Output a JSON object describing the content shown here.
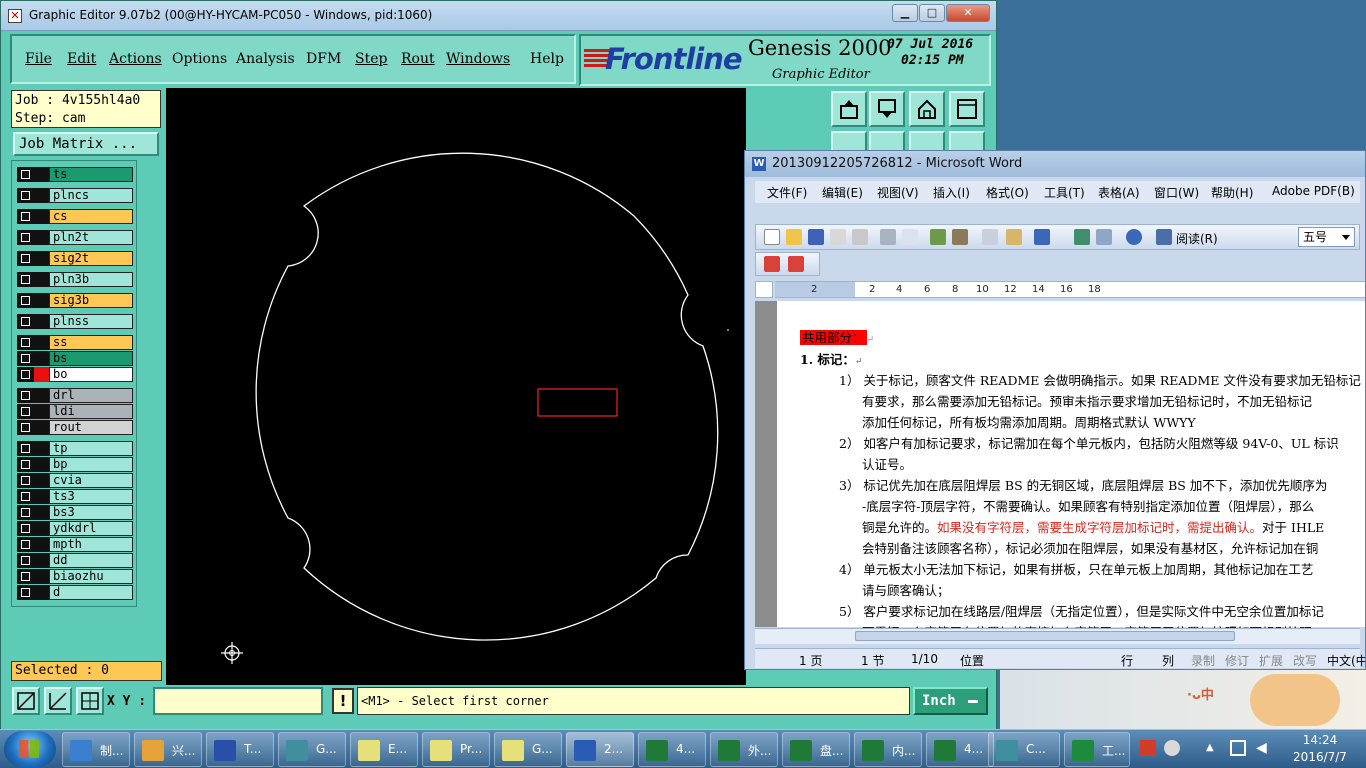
{
  "genesis": {
    "window_title": "Graphic Editor 9.07b2 (00@HY-HYCAM-PC050 - Windows, pid:1060)",
    "menu": [
      "File",
      "Edit",
      "Actions",
      "Options",
      "Analysis",
      "DFM",
      "Step",
      "Rout",
      "Windows",
      "Help"
    ],
    "brand": {
      "logo": "Frontline",
      "product": "Genesis 2000",
      "subtitle": "Graphic Editor",
      "date": "07 Jul 2016",
      "time": "02:15 PM"
    },
    "job_label": "Job : 4v155hl4a0",
    "step_label": "Step: cam",
    "job_matrix_button": "Job Matrix ...",
    "layers": [
      {
        "name": "ts",
        "color": "#1a9a6e"
      },
      {
        "name": "plncs",
        "color": "#9fe6d8"
      },
      {
        "name": "cs",
        "color": "#ffc753"
      },
      {
        "name": "pln2t",
        "color": "#9fe6d8"
      },
      {
        "name": "sig2t",
        "color": "#ffc753"
      },
      {
        "name": "pln3b",
        "color": "#9fe6d8"
      },
      {
        "name": "sig3b",
        "color": "#ffc753"
      },
      {
        "name": "plnss",
        "color": "#9fe6d8"
      },
      {
        "name": "ss",
        "color": "#ffc753"
      },
      {
        "name": "bs",
        "color": "#1a9a6e"
      },
      {
        "name": "bo",
        "color": "#ffffff"
      },
      {
        "name": "drl",
        "color": "#a9b3b8"
      },
      {
        "name": "ldi",
        "color": "#a9b3b8"
      },
      {
        "name": "rout",
        "color": "#d2d2d2"
      },
      {
        "name": "tp",
        "color": "#9fe6d8"
      },
      {
        "name": "bp",
        "color": "#9fe6d8"
      },
      {
        "name": "cvia",
        "color": "#9fe6d8"
      },
      {
        "name": "ts3",
        "color": "#9fe6d8"
      },
      {
        "name": "bs3",
        "color": "#9fe6d8"
      },
      {
        "name": "ydkdrl",
        "color": "#9fe6d8"
      },
      {
        "name": "mpth",
        "color": "#9fe6d8"
      },
      {
        "name": "dd",
        "color": "#9fe6d8"
      },
      {
        "name": "biaozhu",
        "color": "#9fe6d8"
      },
      {
        "name": "d",
        "color": "#9fe6d8"
      }
    ],
    "selected_label": "Selected : 0",
    "xy_label": "X Y :",
    "xy_value": "",
    "exclaim": "!",
    "prompt": "<M1> - Select first corner",
    "units": "Inch"
  },
  "word": {
    "window_title": "20130912205726812 - Microsoft Word",
    "menu": [
      "文件(F)",
      "编辑(E)",
      "视图(V)",
      "插入(I)",
      "格式(O)",
      "工具(T)",
      "表格(A)",
      "窗口(W)",
      "帮助(H)",
      "Adobe PDF(B)"
    ],
    "read_button": "阅读(R)",
    "font_size": "五号",
    "ruler_numbers": [
      "2",
      "2",
      "4",
      "6",
      "8",
      "10",
      "12",
      "14",
      "16",
      "18"
    ],
    "heading": "共用部分：",
    "section": "1.  标记：",
    "paragraphs": [
      "1） 关于标记，顾客文件 README 会做明确指示。如果 README 文件没有要求加无铅标记",
      "有要求，那么需要添加无铅标记。预审未指示要求增加无铅标记时，不加无铅标记",
      "添加任何标记，所有板均需添加周期。周期格式默认 WWYY",
      "2） 如客户有加标记要求，标记需加在每个单元板内，包括防火阻燃等级 94V-0、UL 标识",
      "认证号。",
      "3） 标记优先加在底层阻焊层 BS 的无铜区域，底层阻焊层 BS 加不下，添加优先顺序为",
      "-底层字符-顶层字符，不需要确认。如果顾客有特别指定添加位置（阻焊层），那么",
      "铜是允许的。",
      "如果没有字符层，需要生成字符层加标记时，需提出确认。",
      "对于 IHLE",
      "会特别备注该顾客名称），标记必须加在阻焊层，如果没有基材区，允许标记加在铜",
      "4） 单元板太小无法加下标记，如果有拼板，只在单元板上加周期，其他标记加在工艺",
      "请与顾客确认；",
      "5） 客户要求标记加在线路层/阻焊层（无指定位置），但是实际文件中无空余位置加标记",
      "面露铜，在字符层有位置加的直接加在字符层，字符层无位置加按照如下规则处理"
    ],
    "status": {
      "page": "1 页",
      "section": "1 节",
      "pages": "1/10",
      "position": "位置",
      "line": "行",
      "col": "列",
      "rec": "录制",
      "trk": "修订",
      "ext": "扩展",
      "ovr": "改写",
      "lang": "中文(中"
    }
  },
  "desktop": {
    "deco_text": "·ᴗ中"
  },
  "taskbar": {
    "items": [
      {
        "label": "制...",
        "color": "#3b7fd0"
      },
      {
        "label": "兴...",
        "color": "#e3a23a"
      },
      {
        "label": "T...",
        "color": "#2a4fa8"
      },
      {
        "label": "G...",
        "color": "#3f8f9f"
      },
      {
        "label": "E...",
        "color": "#e6e07a"
      },
      {
        "label": "Pr...",
        "color": "#e6e07a"
      },
      {
        "label": "G...",
        "color": "#e6e07a"
      },
      {
        "label": "2...",
        "color": "#2b5cb3"
      },
      {
        "label": "4...",
        "color": "#1f7a3a"
      },
      {
        "label": "外...",
        "color": "#1f7a3a"
      },
      {
        "label": "盘...",
        "color": "#1f7a3a"
      },
      {
        "label": "内...",
        "color": "#1f7a3a"
      },
      {
        "label": "4...",
        "color": "#1f7a3a"
      },
      {
        "label": "C...",
        "color": "#3f8f9f"
      },
      {
        "label": "工...",
        "color": "#1d8a3d"
      }
    ],
    "clock_time": "14:24",
    "clock_date": "2016/7/7"
  }
}
